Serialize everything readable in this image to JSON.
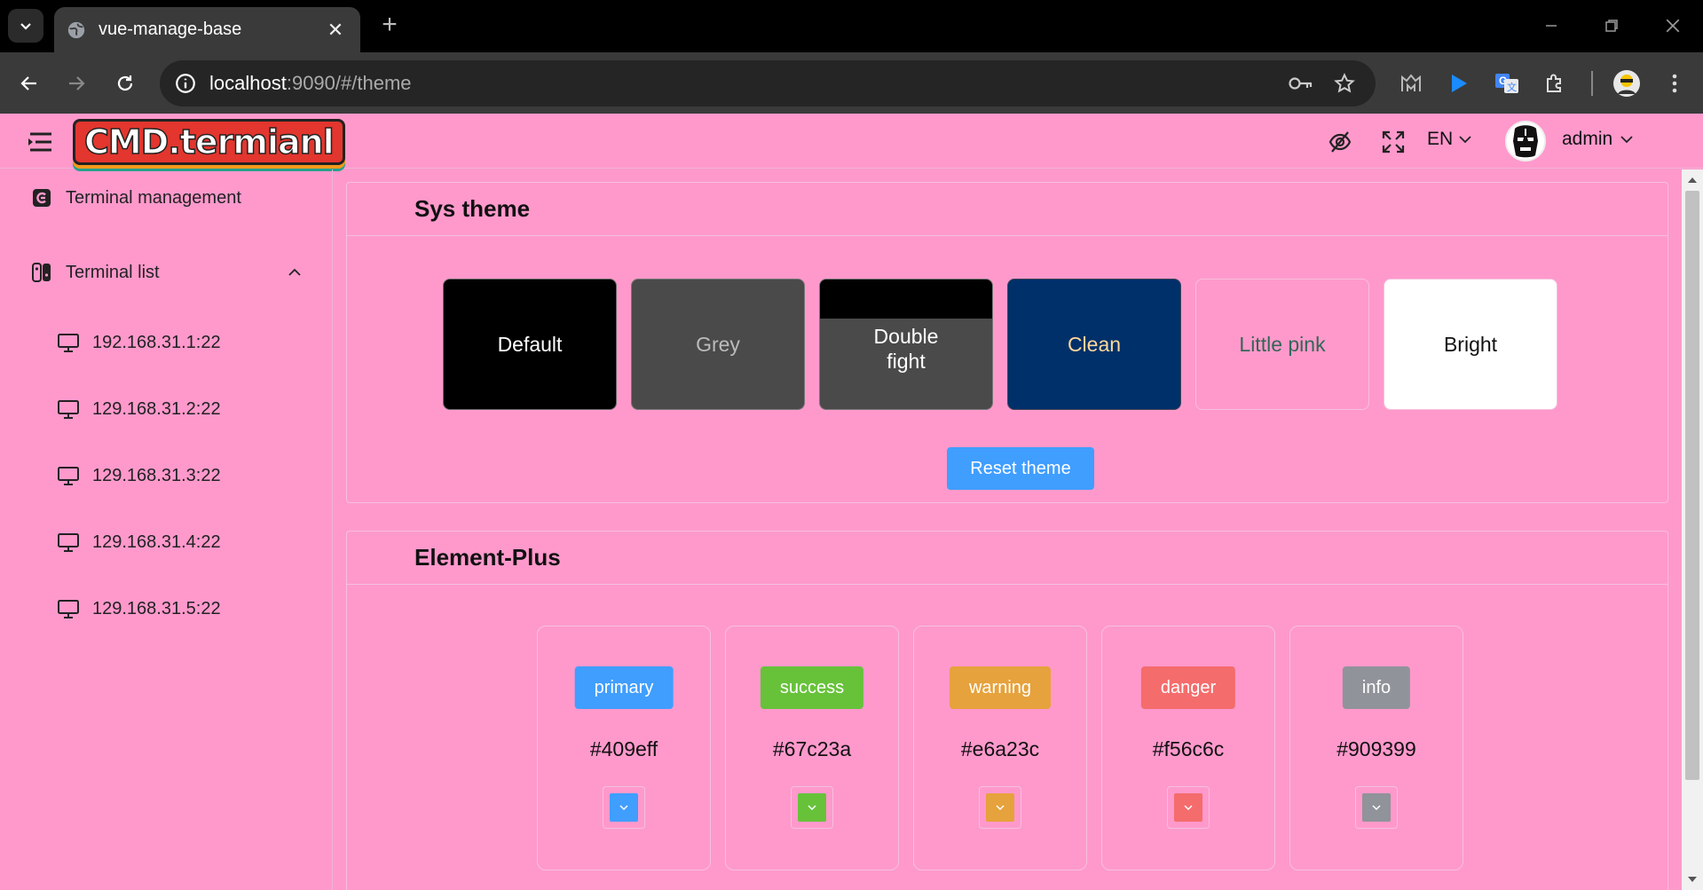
{
  "browser": {
    "tab_title": "vue-manage-base",
    "url_host": "localhost",
    "url_rest": ":9090/#/theme"
  },
  "header": {
    "logo_text": "CMD.termianl",
    "language": "EN",
    "username": "admin"
  },
  "sidebar": {
    "items": [
      {
        "label": "Terminal management",
        "icon": "terminal-icon"
      },
      {
        "label": "Terminal list",
        "icon": "switch-icon",
        "expanded": true
      }
    ],
    "sub_items": [
      {
        "label": "192.168.31.1:22",
        "icon": "monitor-icon"
      },
      {
        "label": "129.168.31.2:22",
        "icon": "monitor-icon"
      },
      {
        "label": "129.168.31.3:22",
        "icon": "monitor-icon"
      },
      {
        "label": "129.168.31.4:22",
        "icon": "monitor-icon"
      },
      {
        "label": "129.168.31.5:22",
        "icon": "monitor-icon"
      }
    ]
  },
  "sys_theme": {
    "title": "Sys theme",
    "themes": [
      {
        "label": "Default",
        "bg": "#000000",
        "fg": "#ffffff"
      },
      {
        "label": "Grey",
        "bg": "#4a4a4a",
        "fg": "#bbbbbb"
      },
      {
        "label": "Double fight",
        "bg": "#4a4a4a",
        "fg": "#ffffff",
        "top": "#000000"
      },
      {
        "label": "Clean",
        "bg": "#00306a",
        "fg": "#ffd89b"
      },
      {
        "label": "Little pink",
        "bg": "#ff99cc",
        "fg": "#336655"
      },
      {
        "label": "Bright",
        "bg": "#ffffff",
        "fg": "#111111"
      }
    ],
    "reset_label": "Reset theme"
  },
  "element_plus": {
    "title": "Element-Plus",
    "colors": [
      {
        "tag": "primary",
        "hex": "#409eff",
        "color": "#409eff"
      },
      {
        "tag": "success",
        "hex": "#67c23a",
        "color": "#67c23a"
      },
      {
        "tag": "warning",
        "hex": "#e6a23c",
        "color": "#e6a23c"
      },
      {
        "tag": "danger",
        "hex": "#f56c6c",
        "color": "#f56c6c"
      },
      {
        "tag": "info",
        "hex": "#909399",
        "color": "#909399"
      }
    ]
  }
}
